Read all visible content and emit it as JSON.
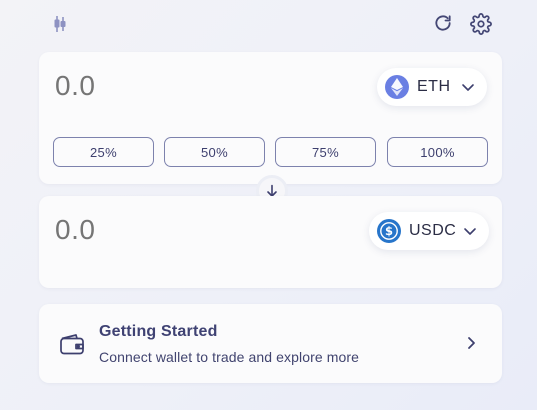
{
  "header": {
    "chart_icon": "candlestick-chart-icon",
    "refresh_icon": "refresh-icon",
    "settings_icon": "gear-icon"
  },
  "from": {
    "amount_placeholder": "0.0",
    "token_symbol": "ETH",
    "token_icon": "ethereum-logo",
    "percent_options": [
      "25%",
      "50%",
      "75%",
      "100%"
    ]
  },
  "switch": {
    "icon": "arrow-down-icon"
  },
  "to": {
    "amount_placeholder": "0.0",
    "token_symbol": "USDC",
    "token_icon": "usdc-logo"
  },
  "getting_started": {
    "title": "Getting Started",
    "subtitle": "Connect wallet to trade and explore more",
    "icon": "wallet-icon"
  },
  "colors": {
    "accent": "#3d3f6e",
    "eth": "#6a7fe3",
    "usdc": "#2775ca",
    "placeholder": "#bcbdc6"
  }
}
